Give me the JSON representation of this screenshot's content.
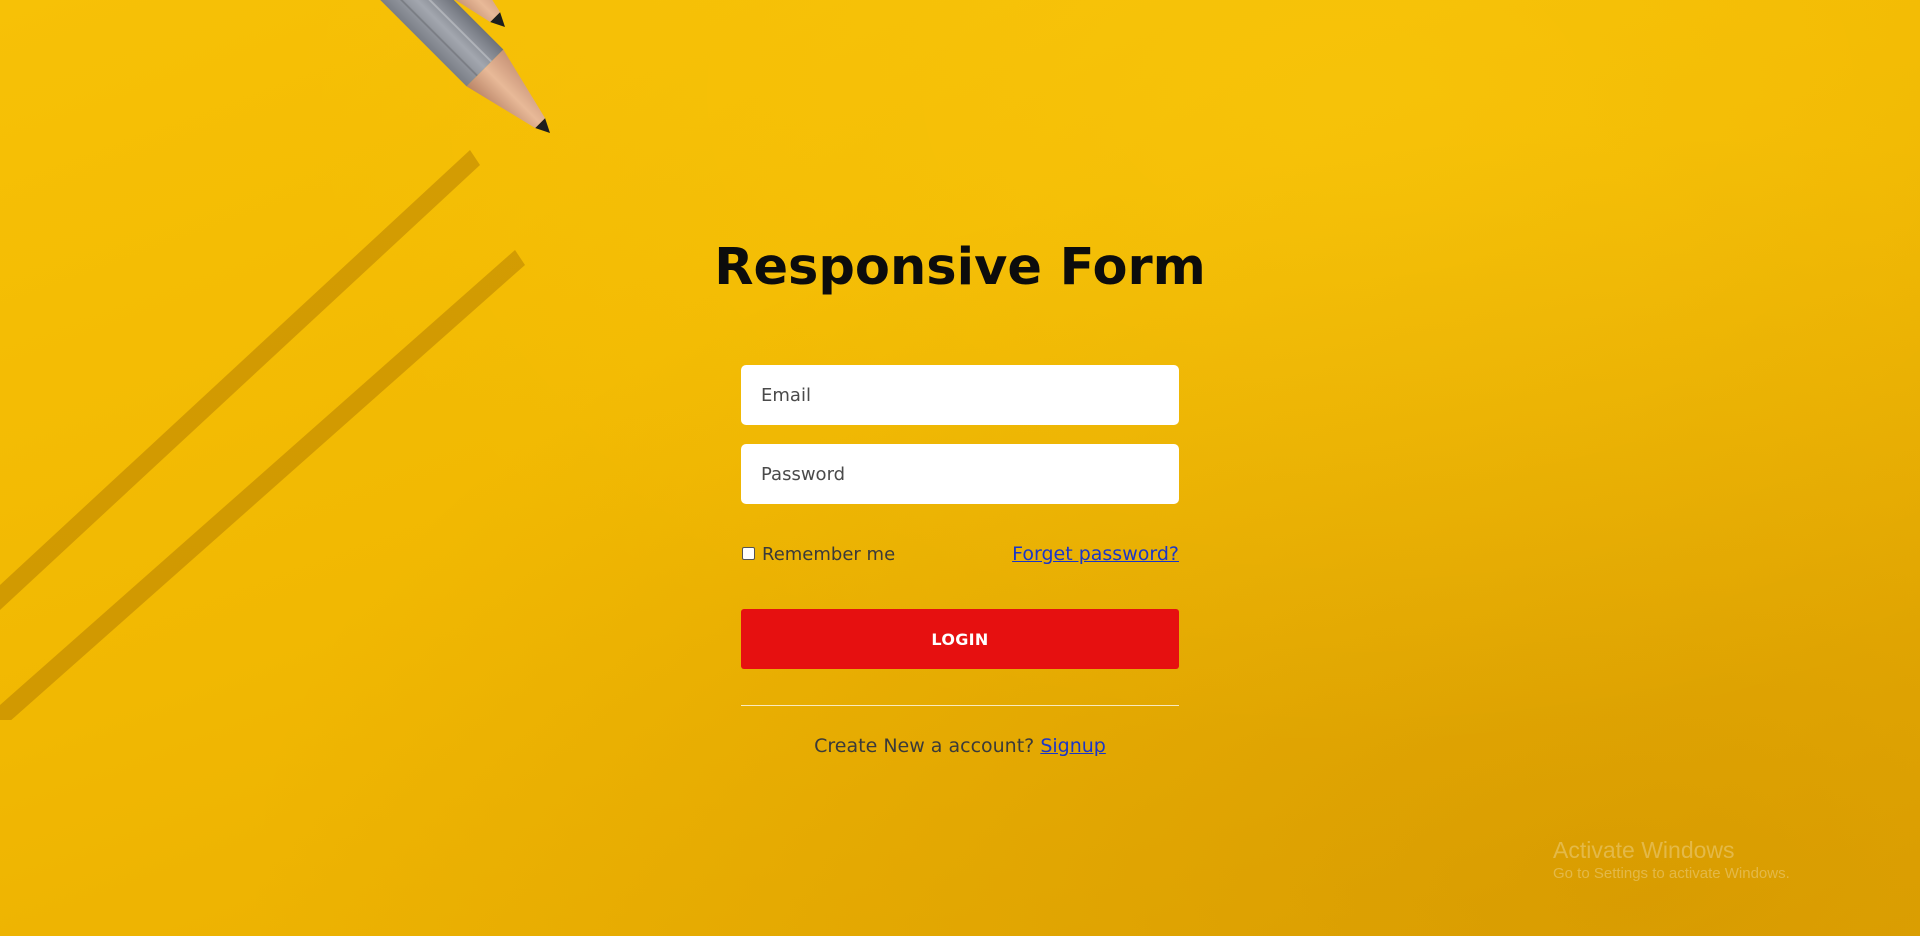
{
  "form": {
    "title": "Responsive Form",
    "email_placeholder": "Email",
    "password_placeholder": "Password",
    "remember_label": "Remember me",
    "remember_checked": false,
    "forgot_link": "Forget password?",
    "login_button": "LOGIN",
    "signup_prompt": "Create New a account?",
    "signup_link": "Signup"
  },
  "watermark": {
    "title": "Activate Windows",
    "subtitle": "Go to Settings to activate Windows."
  },
  "colors": {
    "background": "#f1b802",
    "login_button": "#e61010",
    "link": "#1a36c9",
    "title": "#0c0c0c"
  },
  "icons": {
    "decoration": "pencils-illustration"
  }
}
